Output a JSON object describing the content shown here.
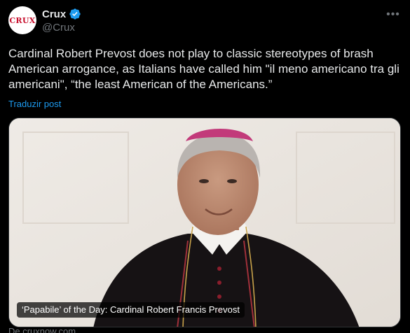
{
  "author": {
    "display_name": "Crux",
    "handle": "@Crux",
    "avatar_text": "CRUX",
    "avatar_icon": "crux-logo"
  },
  "tweet": {
    "text": "Cardinal Robert Prevost does not play to classic stereotypes of brash American arrogance, as Italians have called him \"il meno americano tra gli americani\", “the least American of the Americans.”",
    "translate_label": "Traduzir post"
  },
  "card": {
    "image_caption": "‘Papabile’ of the Day: Cardinal Robert Francis Prevost",
    "source_domain": "De cruxnow.com"
  },
  "colors": {
    "background": "#000000",
    "text": "#e7e9ea",
    "secondary": "#71767b",
    "accent": "#1d9bf0",
    "verified": "#1d9bf0"
  }
}
